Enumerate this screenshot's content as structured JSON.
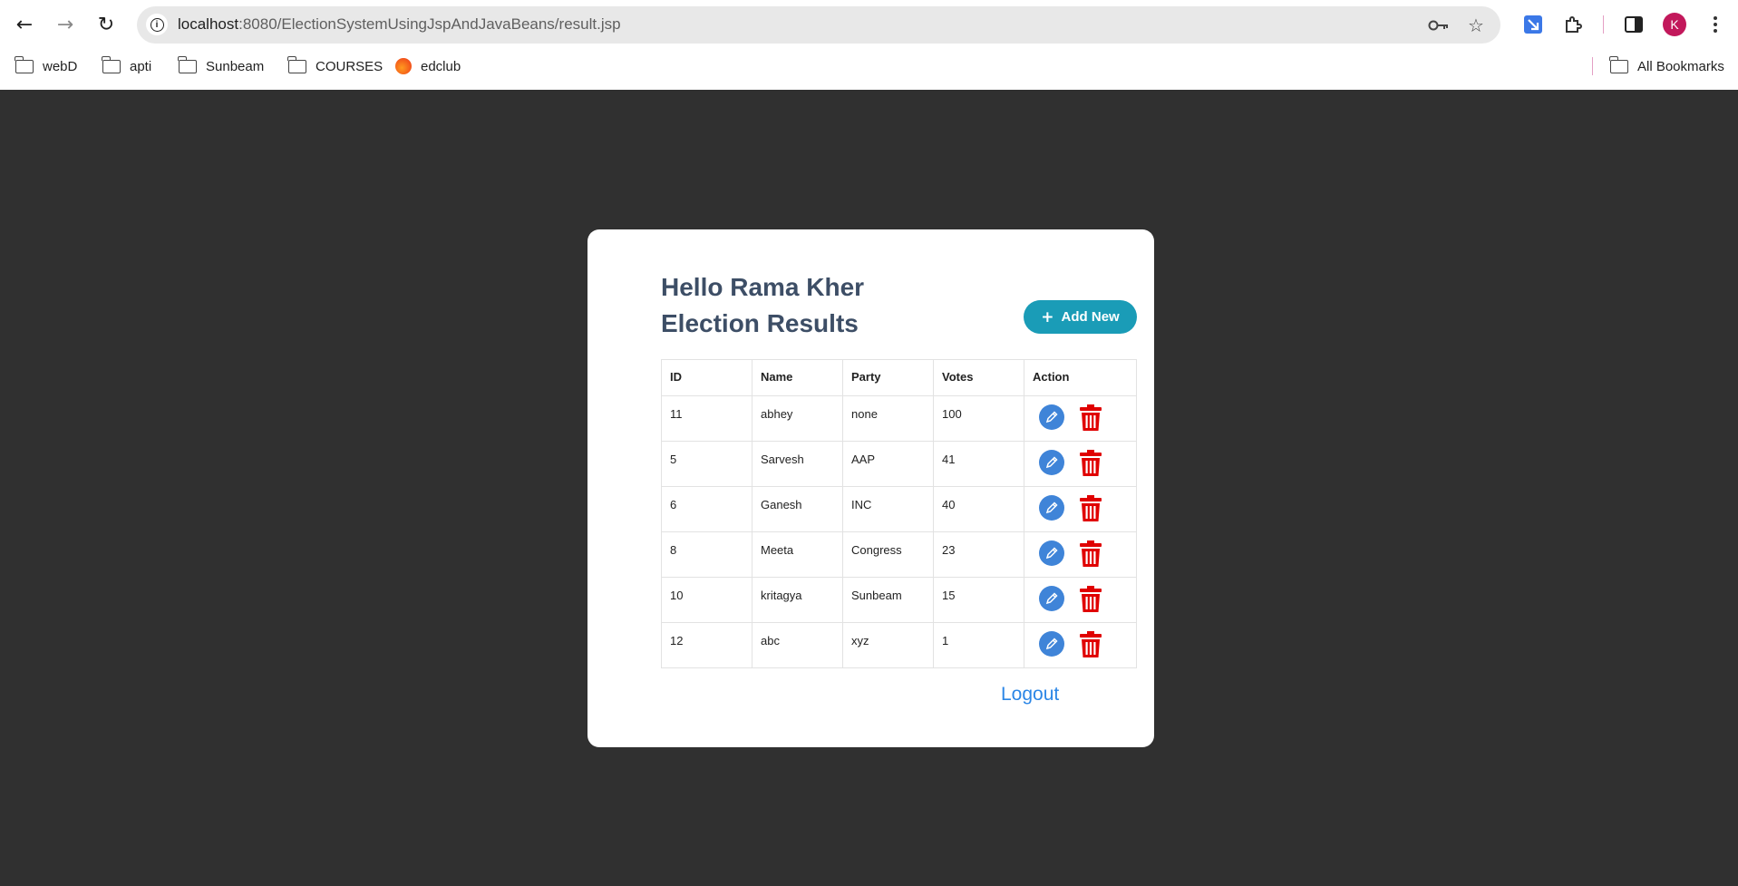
{
  "browser": {
    "url_host": "localhost",
    "url_path": ":8080/ElectionSystemUsingJspAndJavaBeans/result.jsp",
    "avatar_letter": "K",
    "bookmarks": [
      {
        "label": "webD",
        "icon": "folder-icon"
      },
      {
        "label": "apti",
        "icon": "folder-icon"
      },
      {
        "label": "Sunbeam",
        "icon": "folder-icon"
      },
      {
        "label": "COURSES",
        "icon": "folder-icon"
      },
      {
        "label": "edclub",
        "icon": "edclub-logo-icon"
      }
    ],
    "all_bookmarks_label": "All Bookmarks"
  },
  "page": {
    "greeting": "Hello Rama Kher",
    "title": "Election Results",
    "add_button_label": "Add New",
    "logout_label": "Logout"
  },
  "table": {
    "headers": [
      "ID",
      "Name",
      "Party",
      "Votes",
      "Action"
    ],
    "rows": [
      {
        "id": "11",
        "name": "abhey",
        "party": "none",
        "votes": "100"
      },
      {
        "id": "5",
        "name": "Sarvesh",
        "party": "AAP",
        "votes": "41"
      },
      {
        "id": "6",
        "name": "Ganesh",
        "party": "INC",
        "votes": "40"
      },
      {
        "id": "8",
        "name": "Meeta",
        "party": "Congress",
        "votes": "23"
      },
      {
        "id": "10",
        "name": "kritagya",
        "party": "Sunbeam",
        "votes": "15"
      },
      {
        "id": "12",
        "name": "abc",
        "party": "xyz",
        "votes": "1"
      }
    ]
  },
  "colors": {
    "page_background": "#303030",
    "heading": "#3d4e66",
    "add_button": "#1a9cb7",
    "edit_icon": "#3f84d8",
    "delete_icon": "#e00000",
    "logout_link": "#2b86e6"
  }
}
